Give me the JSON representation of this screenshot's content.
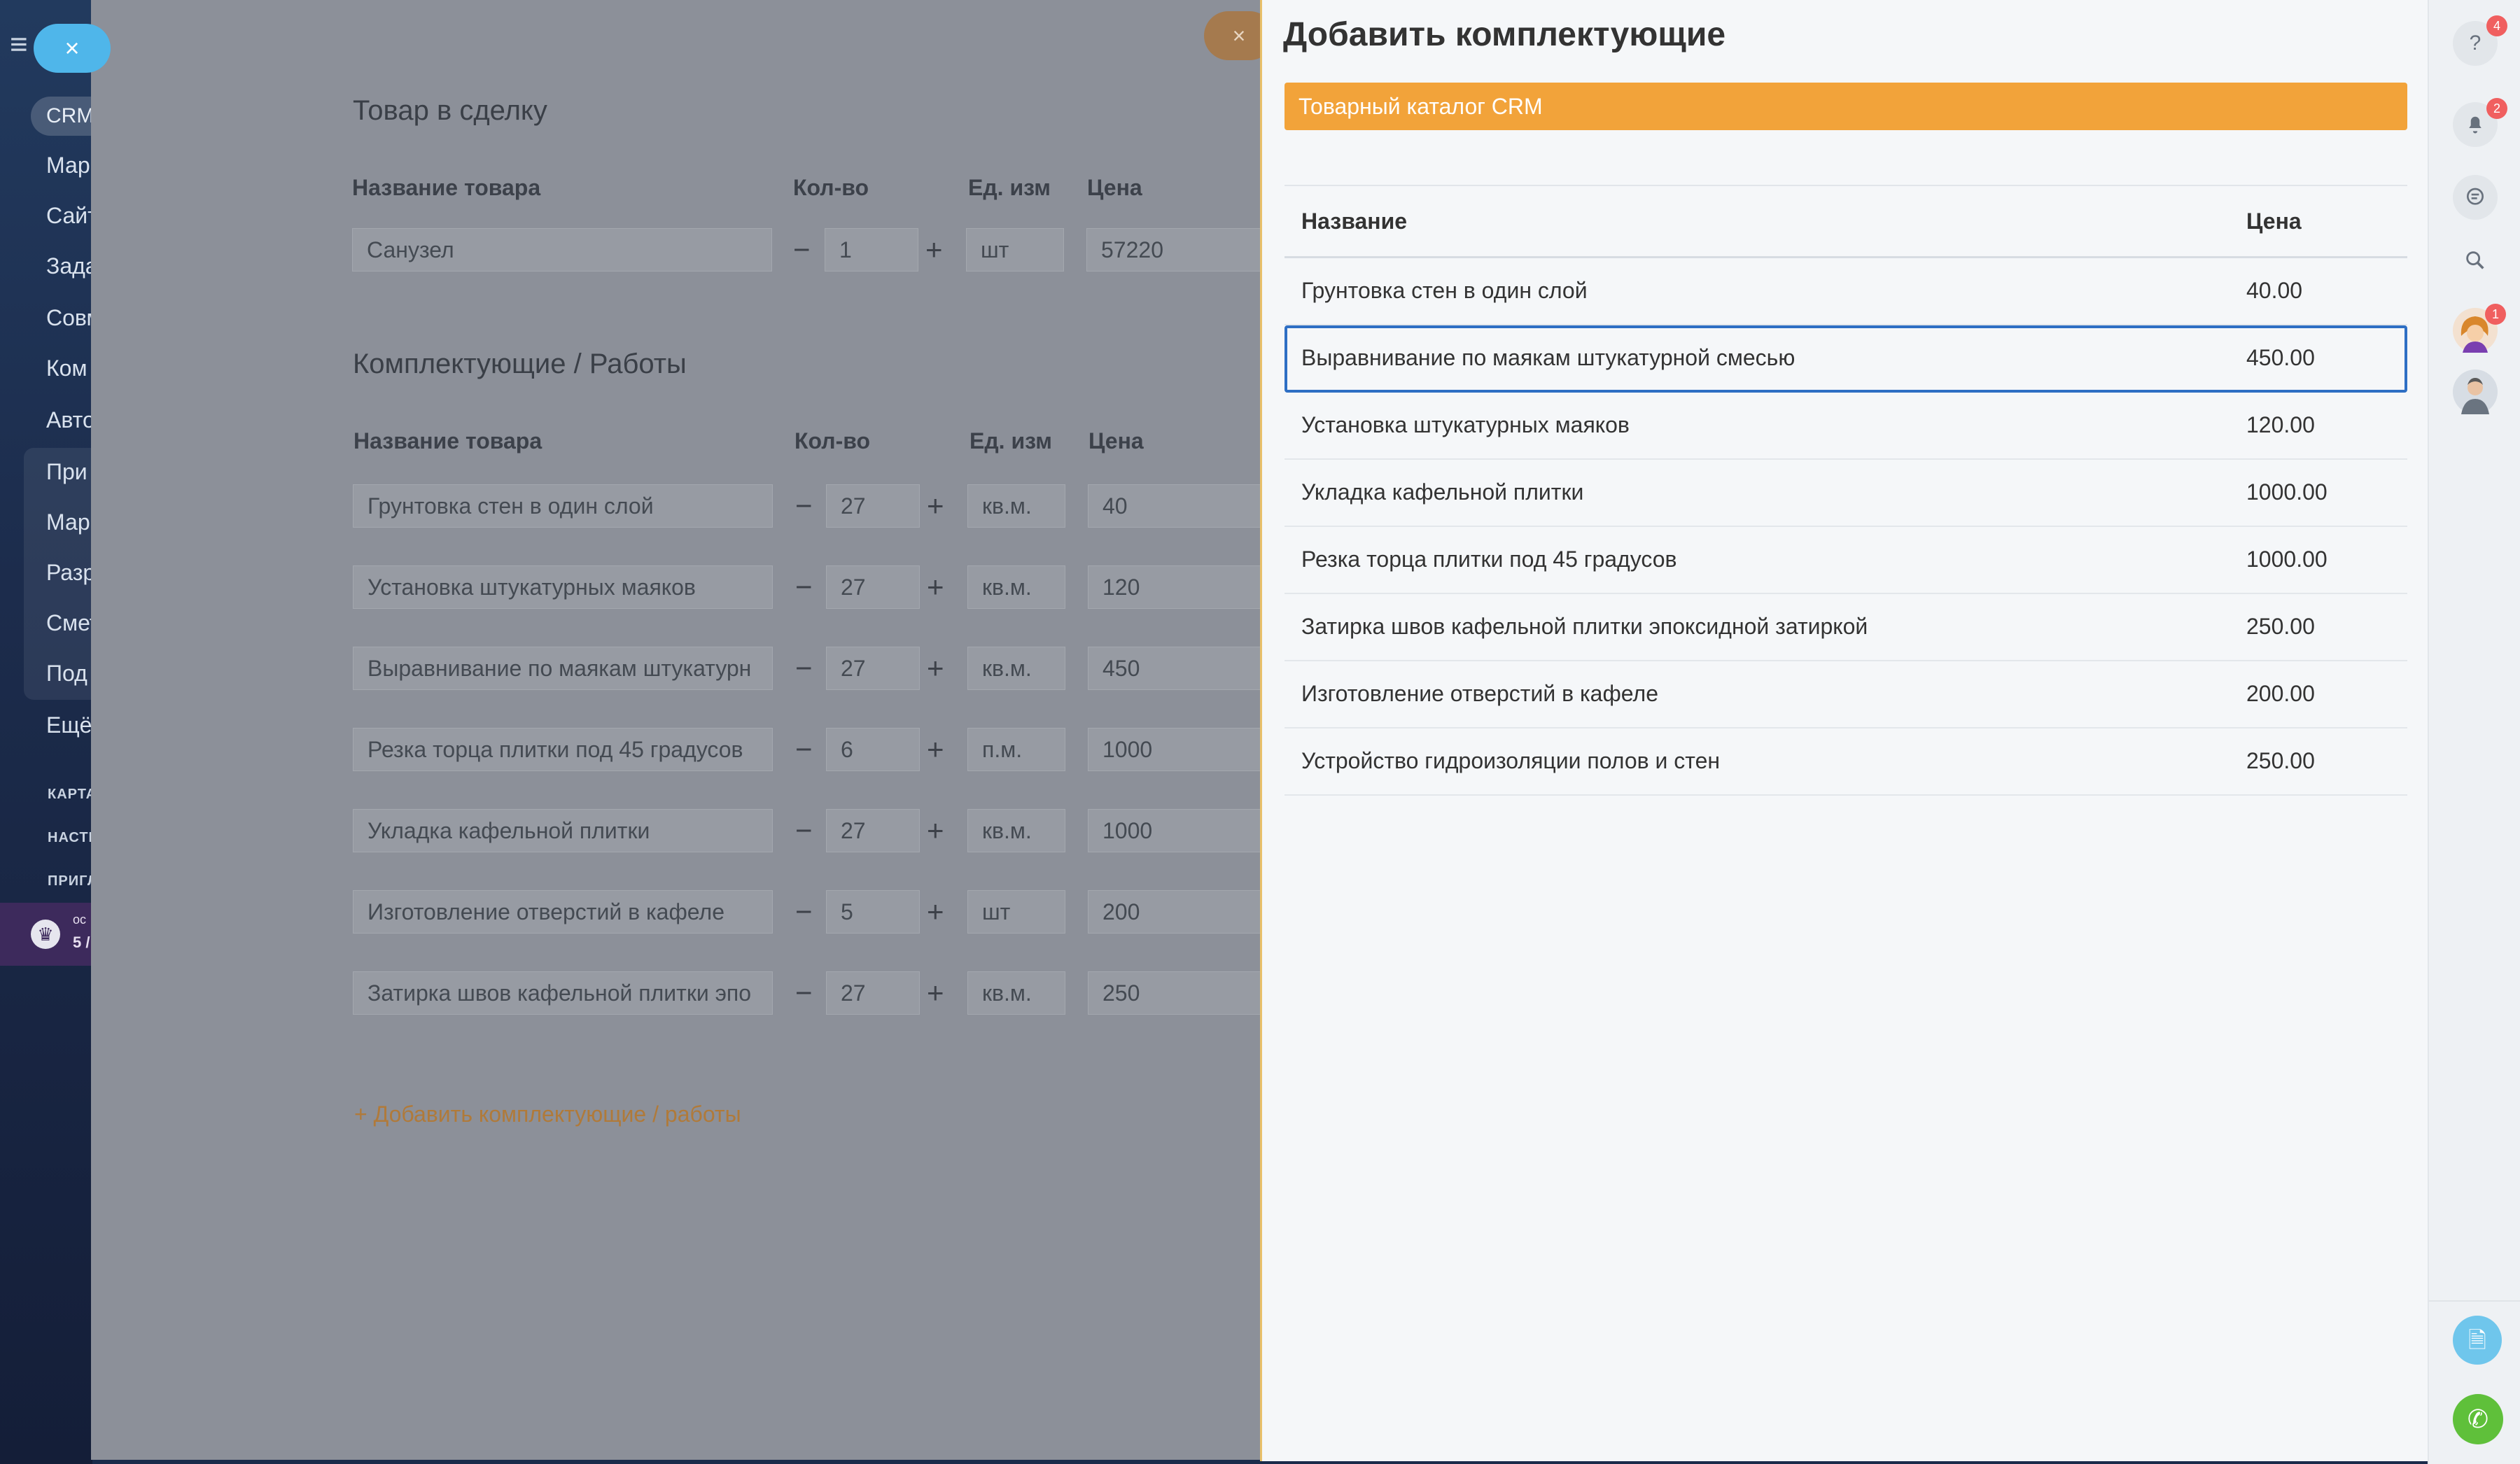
{
  "left_nav": {
    "crm_chip": "CRM",
    "items": [
      "Мар",
      "Сайт",
      "Зада",
      "Совм",
      "Ком",
      "Авто",
      "При",
      "Мар",
      "Разр",
      "Смет",
      "Под",
      "Ещё"
    ],
    "small_links": [
      "КАРТА",
      "НАСТР",
      "ПРИГЛ"
    ],
    "promo_line1": "ос",
    "promo_line2": "5 /"
  },
  "form": {
    "title": "Товар в сделку",
    "headers": {
      "name": "Название товара",
      "qty": "Кол-во",
      "unit": "Ед. изм",
      "price": "Цена"
    },
    "main_product": {
      "name": "Санузел",
      "qty": "1",
      "unit": "шт",
      "price": "57220"
    },
    "components_title": "Комплектующие / Работы",
    "components": [
      {
        "name": "Грунтовка стен в один слой",
        "qty": "27",
        "unit": "кв.м.",
        "price": "40"
      },
      {
        "name": "Установка штукатурных маяков",
        "qty": "27",
        "unit": "кв.м.",
        "price": "120"
      },
      {
        "name": "Выравнивание по маякам штукатурн",
        "qty": "27",
        "unit": "кв.м.",
        "price": "450"
      },
      {
        "name": "Резка торца плитки под 45 градусов",
        "qty": "6",
        "unit": "п.м.",
        "price": "1000"
      },
      {
        "name": "Укладка кафельной плитки",
        "qty": "27",
        "unit": "кв.м.",
        "price": "1000"
      },
      {
        "name": "Изготовление отверстий в кафеле",
        "qty": "5",
        "unit": "шт",
        "price": "200"
      },
      {
        "name": "Затирка швов кафельной плитки эпо",
        "qty": "27",
        "unit": "кв.м.",
        "price": "250"
      }
    ],
    "minus": "−",
    "plus": "+",
    "add_link": "+ Добавить комплектующие / работы"
  },
  "slider": {
    "title": "Добавить комплектующие",
    "catalog_tab": "Товарный каталог CRM",
    "columns": {
      "name": "Название",
      "price": "Цена"
    },
    "rows": [
      {
        "name": "Грунтовка стен в один слой",
        "price": "40.00"
      },
      {
        "name": "Выравнивание по маякам штукатурной смесью",
        "price": "450.00",
        "selected": true
      },
      {
        "name": "Установка штукатурных маяков",
        "price": "120.00"
      },
      {
        "name": "Укладка кафельной плитки",
        "price": "1000.00"
      },
      {
        "name": "Резка торца плитки под 45 градусов",
        "price": "1000.00"
      },
      {
        "name": "Затирка швов кафельной плитки эпоксидной затиркой",
        "price": "250.00"
      },
      {
        "name": "Изготовление отверстий в кафеле",
        "price": "200.00"
      },
      {
        "name": "Устройство гидроизоляции полов и стен",
        "price": "250.00"
      }
    ]
  },
  "right_rail": {
    "help_badge": "4",
    "notifications_badge": "2",
    "avatar_badge": "1"
  },
  "icons": {
    "close": "×",
    "menu": "≡",
    "help": "?",
    "bell": "🔔",
    "chat": "💬",
    "search": "⌕",
    "document": "🗎",
    "phone": "✆",
    "crown": "♛"
  },
  "colors": {
    "accent_orange": "#f2a33a",
    "selected_border": "#2e6fc4",
    "call_green": "#5fc03a",
    "badge_red": "#f05f5f"
  }
}
